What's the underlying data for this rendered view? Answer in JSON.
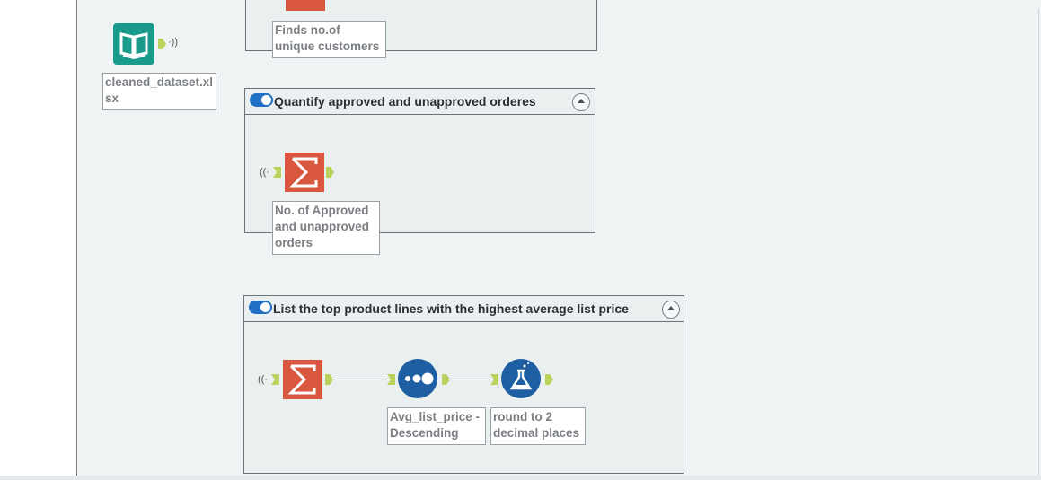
{
  "input_tool": {
    "icon": "book-icon",
    "label": "cleaned_dataset.xlsx",
    "label_line1": "cleaned_dataset.xl",
    "label_line2": "sx"
  },
  "containers": [
    {
      "title": "",
      "tool_label_line1": "Finds no.of",
      "tool_label_line2": "unique customers"
    },
    {
      "title": "Quantify approved and unapproved orderes",
      "tool_label_line1": "No. of Approved",
      "tool_label_line2": "and unapproved",
      "tool_label_line3": "orders"
    },
    {
      "title": "List the top product lines with the highest average list price",
      "sort_label_line1": "Avg_list_price -",
      "sort_label_line2": "Descending",
      "formula_label_line1": "round to 2",
      "formula_label_line2": "decimal places"
    }
  ],
  "icons": {
    "summarize": "sigma-icon",
    "sort": "sort-dots-icon",
    "formula": "flask-icon",
    "toggle": "toggle-switch-icon",
    "collapse": "chevron-up-icon"
  },
  "colors": {
    "canvas": "#eff3f4",
    "summarize": "#d9573f",
    "sort_formula": "#1e5fa3",
    "input": "#1a9a8a",
    "anchor": "#b9d25b",
    "toggle": "#1f6fc5"
  }
}
